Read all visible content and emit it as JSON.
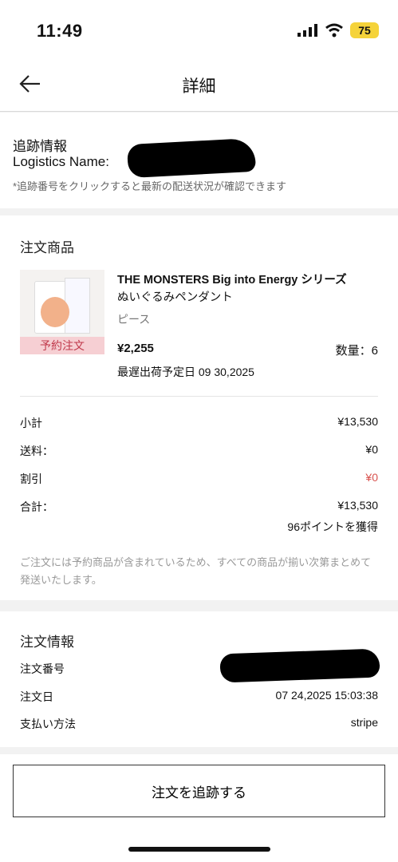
{
  "status_bar": {
    "time": "11:49",
    "battery": "75"
  },
  "nav": {
    "title": "詳細"
  },
  "tracking": {
    "title": "追跡情報",
    "logistics_label": "Logistics Name:",
    "note": "*追跡番号をクリックすると最新の配送状況が確認できます"
  },
  "products": {
    "title": "注文商品",
    "item": {
      "name_line1": "THE MONSTERS Big into Energy シリーズ",
      "name_line2": "ぬいぐるみペンダント",
      "variant": "ピース",
      "tag": "予約注文",
      "price": "¥2,255",
      "quantity": "数量：6",
      "ship_date": "最遅出荷予定日 09 30,2025"
    },
    "summary": [
      {
        "label": "小計",
        "value": "¥13,530"
      },
      {
        "label": "送料：",
        "value": "¥0"
      },
      {
        "label": "割引",
        "value": "¥0"
      },
      {
        "label": "合計：",
        "value": "¥13,530"
      }
    ],
    "points": "96ポイントを獲得",
    "notice": "ご注文には予約商品が含まれているため、すべての商品が揃い次第まとめて発送いたします。"
  },
  "order_info": {
    "title": "注文情報",
    "order_number_label": "注文番号",
    "order_date_label": "注文日",
    "order_date": "07 24,2025 15:03:38",
    "payment_label": "支払い方法",
    "payment": "stripe"
  },
  "bottom": {
    "track_button": "注文を追跡する"
  },
  "colors": {
    "discount": "#d9534f",
    "tag_bg": "#f6cfd3",
    "battery": "#f5d33a"
  }
}
